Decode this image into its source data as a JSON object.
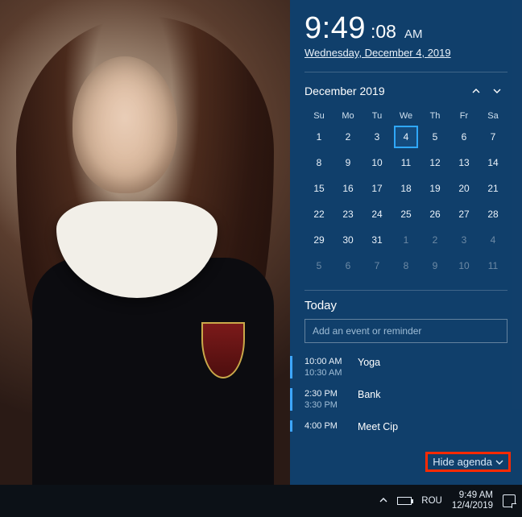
{
  "clock": {
    "time": "9:49",
    "seconds": ":08",
    "ampm": "AM",
    "date": "Wednesday, December 4, 2019"
  },
  "calendar": {
    "month_label": "December 2019",
    "dow": [
      "Su",
      "Mo",
      "Tu",
      "We",
      "Th",
      "Fr",
      "Sa"
    ],
    "weeks": [
      [
        {
          "n": "1"
        },
        {
          "n": "2"
        },
        {
          "n": "3"
        },
        {
          "n": "4",
          "today": true
        },
        {
          "n": "5"
        },
        {
          "n": "6"
        },
        {
          "n": "7"
        }
      ],
      [
        {
          "n": "8"
        },
        {
          "n": "9"
        },
        {
          "n": "10"
        },
        {
          "n": "11"
        },
        {
          "n": "12"
        },
        {
          "n": "13"
        },
        {
          "n": "14"
        }
      ],
      [
        {
          "n": "15"
        },
        {
          "n": "16"
        },
        {
          "n": "17"
        },
        {
          "n": "18"
        },
        {
          "n": "19"
        },
        {
          "n": "20"
        },
        {
          "n": "21"
        }
      ],
      [
        {
          "n": "22"
        },
        {
          "n": "23"
        },
        {
          "n": "24"
        },
        {
          "n": "25"
        },
        {
          "n": "26"
        },
        {
          "n": "27"
        },
        {
          "n": "28"
        }
      ],
      [
        {
          "n": "29"
        },
        {
          "n": "30"
        },
        {
          "n": "31"
        },
        {
          "n": "1",
          "dim": true
        },
        {
          "n": "2",
          "dim": true
        },
        {
          "n": "3",
          "dim": true
        },
        {
          "n": "4",
          "dim": true
        }
      ],
      [
        {
          "n": "5",
          "dim": true
        },
        {
          "n": "6",
          "dim": true
        },
        {
          "n": "7",
          "dim": true
        },
        {
          "n": "8",
          "dim": true
        },
        {
          "n": "9",
          "dim": true
        },
        {
          "n": "10",
          "dim": true
        },
        {
          "n": "11",
          "dim": true
        }
      ]
    ]
  },
  "agenda": {
    "title": "Today",
    "placeholder": "Add an event or reminder",
    "events": [
      {
        "start": "10:00 AM",
        "end": "10:30 AM",
        "title": "Yoga"
      },
      {
        "start": "2:30 PM",
        "end": "3:30 PM",
        "title": "Bank"
      },
      {
        "start": "4:00 PM",
        "end": "",
        "title": "Meet Cip"
      }
    ],
    "hide_label": "Hide agenda"
  },
  "taskbar": {
    "lang": "ROU",
    "time": "9:49 AM",
    "date": "12/4/2019"
  }
}
